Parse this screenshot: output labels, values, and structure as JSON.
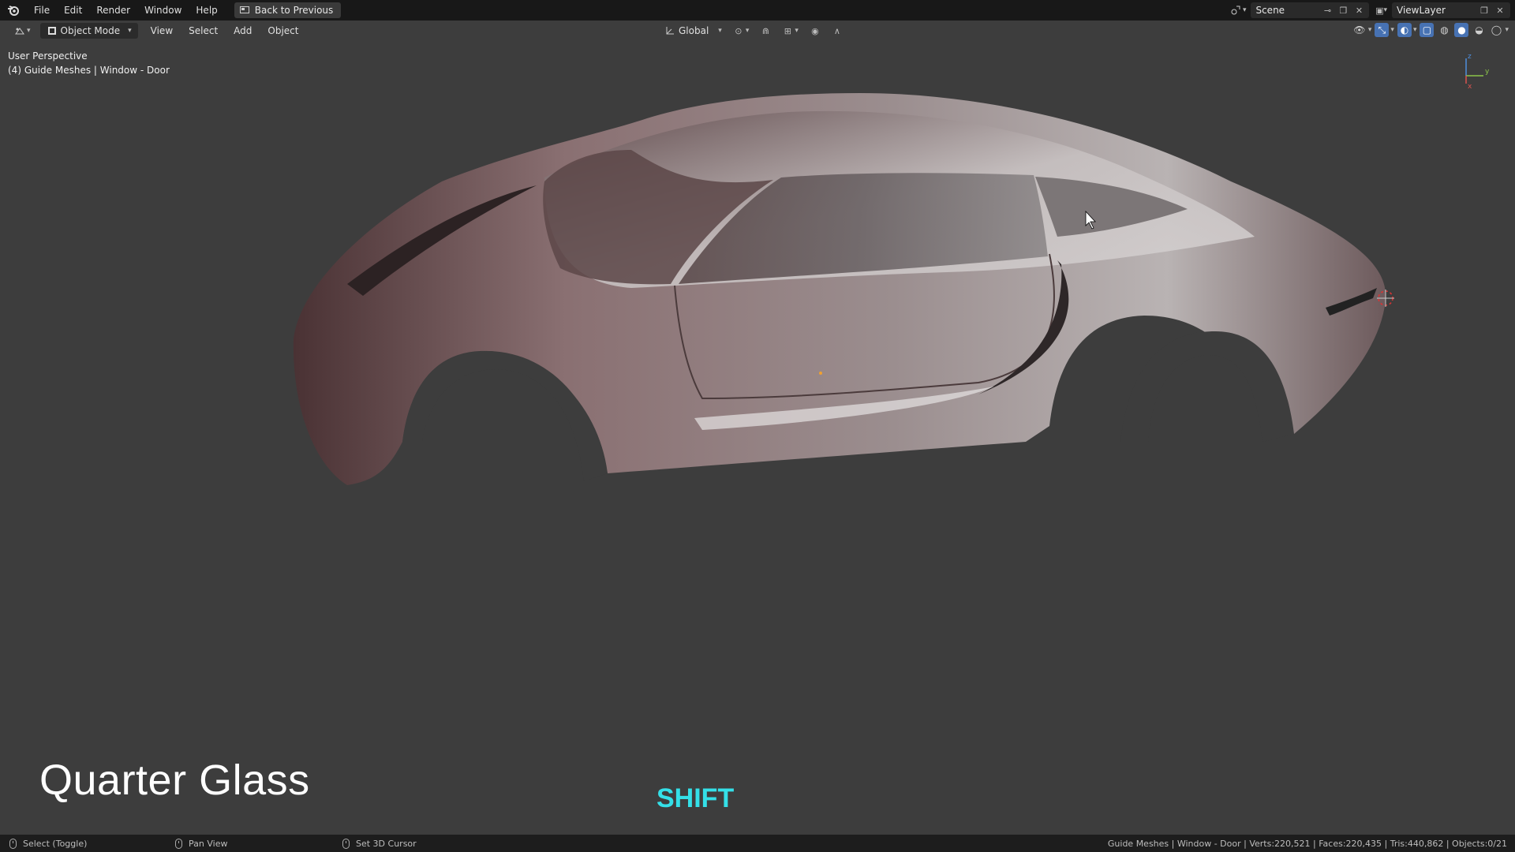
{
  "topbar": {
    "menus": [
      "File",
      "Edit",
      "Render",
      "Window",
      "Help"
    ],
    "back_label": "Back to Previous",
    "scene": "Scene",
    "view_layer": "ViewLayer"
  },
  "header": {
    "mode": "Object Mode",
    "menus": [
      "View",
      "Select",
      "Add",
      "Object"
    ],
    "orientation": "Global"
  },
  "viewport": {
    "perspective": "User Perspective",
    "object_info": "(4) Guide Meshes | Window - Door",
    "axis_x": "x",
    "axis_y": "y",
    "axis_z": "z"
  },
  "overlay": {
    "title": "Quarter Glass",
    "key": "SHIFT"
  },
  "statusbar": {
    "hint_select": "Select (Toggle)",
    "hint_pan": "Pan View",
    "hint_cursor": "Set 3D Cursor",
    "stats": "Guide Meshes | Window - Door | Verts:220,521 | Faces:220,435 | Tris:440,862 | Objects:0/21"
  },
  "colors": {
    "viewport_bg": "#3d3d3d",
    "topbar_bg": "#181818",
    "accent_blue": "#4772b3",
    "key_cyan": "#34e0e8"
  }
}
